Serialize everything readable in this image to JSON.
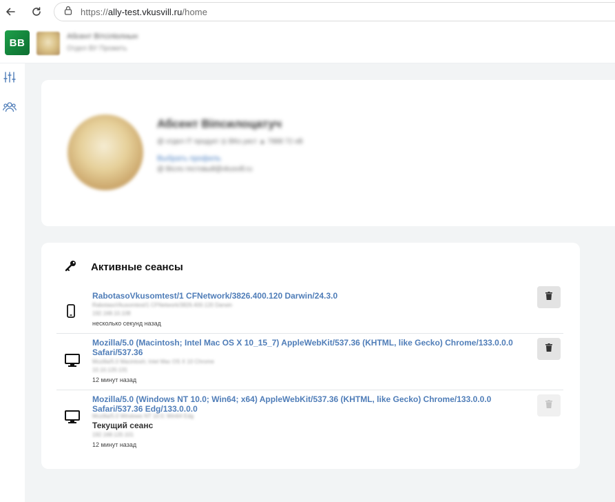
{
  "browser": {
    "url_prefix": "https://",
    "url_host": "ally-test.vkusvill.ru",
    "url_path": "/home"
  },
  "header": {
    "logo_text": "BB",
    "user_name": "Абсент Вітсіліолнын",
    "user_role": "Отдел ВУ Прожить"
  },
  "sidebar": {
    "items": [
      {
        "icon": "sliders-icon"
      },
      {
        "icon": "users-icon"
      }
    ]
  },
  "profile": {
    "name": "Абсент Віпсилоцатуч",
    "meta": "@ отдел IT продукт   ◎ ВКо.уист   ▲ 7888 72 нВ",
    "link": "Выбрать профиль",
    "email": "@ Вісло.тестовый@vkusvill.ru"
  },
  "sessions": {
    "title": "Активные сеансы",
    "items": [
      {
        "device": "phone",
        "user_agent": "RabotasoVkusomtest/1 CFNetwork/3826.400.120 Darwin/24.3.0",
        "blur1": "RabotasoVkusomtest/1 CFNetwork/3826.400.120 Darwin",
        "blur2": "192.168.10.108",
        "current_label": "",
        "time": "несколько секунд назад",
        "delete_enabled": true
      },
      {
        "device": "desktop",
        "user_agent": "Mozilla/5.0 (Macintosh; Intel Mac OS X 10_15_7) AppleWebKit/537.36 (KHTML, like Gecko) Chrome/133.0.0.0 Safari/537.36",
        "blur1": "Mozilla/5.0 Macintosh; Intel Mac OS X 10 Chrome",
        "blur2": "10.10.120.131",
        "current_label": "",
        "time": "12 минут назад",
        "delete_enabled": true
      },
      {
        "device": "desktop",
        "user_agent": "Mozilla/5.0 (Windows NT 10.0; Win64; x64) AppleWebKit/537.36 (KHTML, like Gecko) Chrome/133.0.0.0 Safari/537.36 Edg/133.0.0.0",
        "blur1": "Mozilla/5.0 Windows NT 10.0; Win64 Edg",
        "blur2": "192.168.120.101",
        "current_label": "Текущий сеанс",
        "time": "12 минут назад",
        "delete_enabled": false
      }
    ]
  },
  "colors": {
    "brand_green": "#1fa04a",
    "link_blue": "#4f7db8",
    "page_bg": "#f2f4f5"
  }
}
